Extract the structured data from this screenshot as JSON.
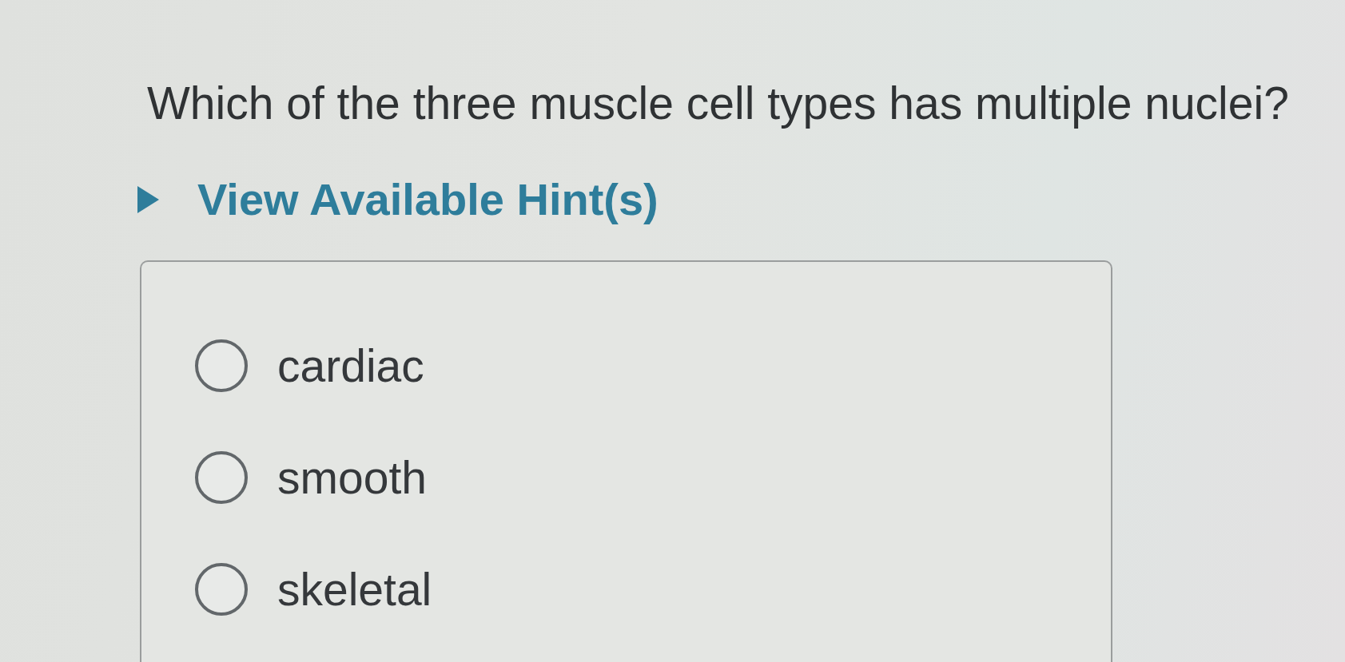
{
  "question": "Which of the three muscle cell types has multiple nuclei?",
  "hint": {
    "label": "View Available Hint(s)",
    "expanded": false
  },
  "options": [
    {
      "label": "cardiac",
      "selected": false
    },
    {
      "label": "smooth",
      "selected": false
    },
    {
      "label": "skeletal",
      "selected": false
    }
  ]
}
